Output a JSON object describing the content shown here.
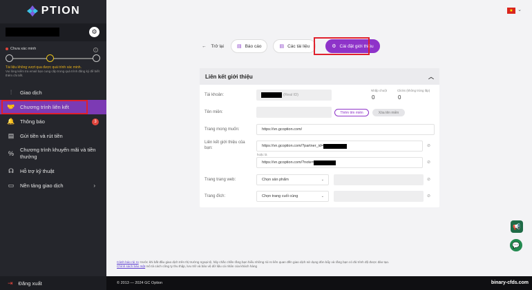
{
  "brand": {
    "logo_text": "PTION"
  },
  "sidebar": {
    "verify_status": "Chưa xác minh",
    "info_icon": "i",
    "verify_warning": "Tài liệu không vượt qua được quá trình xác minh.",
    "verify_help": "Vui lòng kiểm tra email bạn cung cấp trong quá trình đăng ký để biết thêm chi tiết.",
    "items": [
      {
        "label": "Giao dịch",
        "icon": "trading-icon"
      },
      {
        "label": "Chương trình liên kết",
        "icon": "handshake-icon"
      },
      {
        "label": "Thông báo",
        "icon": "bell-icon",
        "badge": "3"
      },
      {
        "label": "Gửi tiền và rút tiền",
        "icon": "wallet-icon"
      },
      {
        "label": "Chương trình khuyến mãi và tiền thưởng",
        "icon": "percent-icon"
      },
      {
        "label": "Hỗ trợ kỹ thuật",
        "icon": "headset-icon"
      },
      {
        "label": "Nền tảng giao dịch",
        "icon": "monitor-icon"
      }
    ],
    "logout": "Đăng xuất"
  },
  "toolbar": {
    "back": "Trở lại",
    "report": "Báo cáo",
    "docs": "Các tài liệu",
    "settings": "Cài đặt giới thiệu"
  },
  "panel": {
    "title": "Liên kết giới thiệu",
    "account_label": "Tài khoản:",
    "account_suffix": "(Real ID)",
    "clicks_label": "Nhấp chuột",
    "clicks_value": "0",
    "unique_clicks_label": "Clicks (không trùng lặp)",
    "unique_clicks_value": "0",
    "domain_label": "Tên miền:",
    "add_domain": "Thêm tên miền",
    "delete_domain": "Xóa tên miền",
    "desired_page_label": "Trang mong muốn:",
    "desired_page_value": "https://vn.gcoption.com/",
    "ref_link_label": "Liên kết giới thiệu của bạn:",
    "ref_link_1": "https://vn.gcoption.com/?partner_id=",
    "or_label": "hoặc là",
    "ref_link_2": "https://vn.gcoption.com/?note=",
    "web_page_label": "Trang trang web:",
    "web_page_select": "Chọn sản phẩm",
    "target_page_label": "Trang đích:",
    "target_page_select": "Chọn trang cuối cùng"
  },
  "disclaimer": {
    "risk_link": "Cảnh báo rủi ro",
    "risk_text": ": trước khi bắt đầu giao dịch trên thị trường ngoại tệ, hãy chắc chắn rằng bạn hiểu những rủi ro liên quan đến giao dịch sử dụng đòn bẩy và rằng bạn có đủ trình độ được đào tạo.",
    "privacy_link": "Chính sách bảo mật",
    "privacy_text": " mô tả cách công ty thu thập, lưu trữ và bảo vệ dữ liệu cá nhân của khách hàng"
  },
  "footer": {
    "copyright": "© 2013 — 2024 GC Option",
    "watermark": "binary-cfds.com"
  },
  "colors": {
    "accent": "#8e33c9",
    "sidebar": "#25262c",
    "highlight": "#e0202c"
  }
}
